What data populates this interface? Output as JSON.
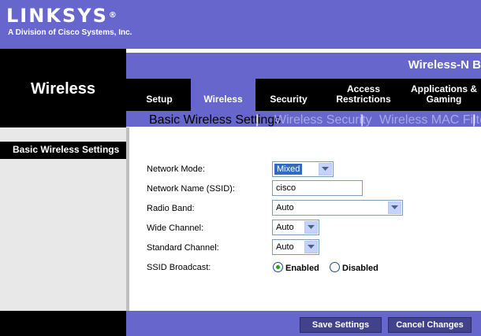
{
  "brand": {
    "logo_text": "LINKSYS",
    "logo_mark": "®",
    "tagline": "A Division of Cisco Systems, Inc."
  },
  "section_title": "Wireless",
  "model_name": "Wireless-N B",
  "tabs": [
    {
      "label": "Setup"
    },
    {
      "label": "Wireless"
    },
    {
      "label": "Security"
    },
    {
      "label": "Access Restrictions"
    },
    {
      "label": "Applications & Gaming"
    }
  ],
  "subnav": {
    "items": [
      {
        "label": "Basic Wireless Settings"
      },
      {
        "label": "Wireless Security"
      },
      {
        "label": "Wireless MAC Filter"
      }
    ],
    "separator": "|"
  },
  "sidebar": {
    "label": "Basic Wireless Settings"
  },
  "form": {
    "network_mode": {
      "label": "Network Mode:",
      "value": "Mixed"
    },
    "ssid": {
      "label": "Network Name (SSID):",
      "value": "cisco"
    },
    "radio_band": {
      "label": "Radio Band:",
      "value": "Auto"
    },
    "wide_channel": {
      "label": "Wide Channel:",
      "value": "Auto"
    },
    "standard_channel": {
      "label": "Standard Channel:",
      "value": "Auto"
    },
    "ssid_broadcast": {
      "label": "SSID Broadcast:",
      "enabled_label": "Enabled",
      "disabled_label": "Disabled",
      "selected": "Enabled"
    }
  },
  "buttons": {
    "save": "Save Settings",
    "cancel": "Cancel Changes"
  },
  "colors": {
    "brand_purple": "#6666cc",
    "black": "#000000",
    "button": "#42428a"
  }
}
